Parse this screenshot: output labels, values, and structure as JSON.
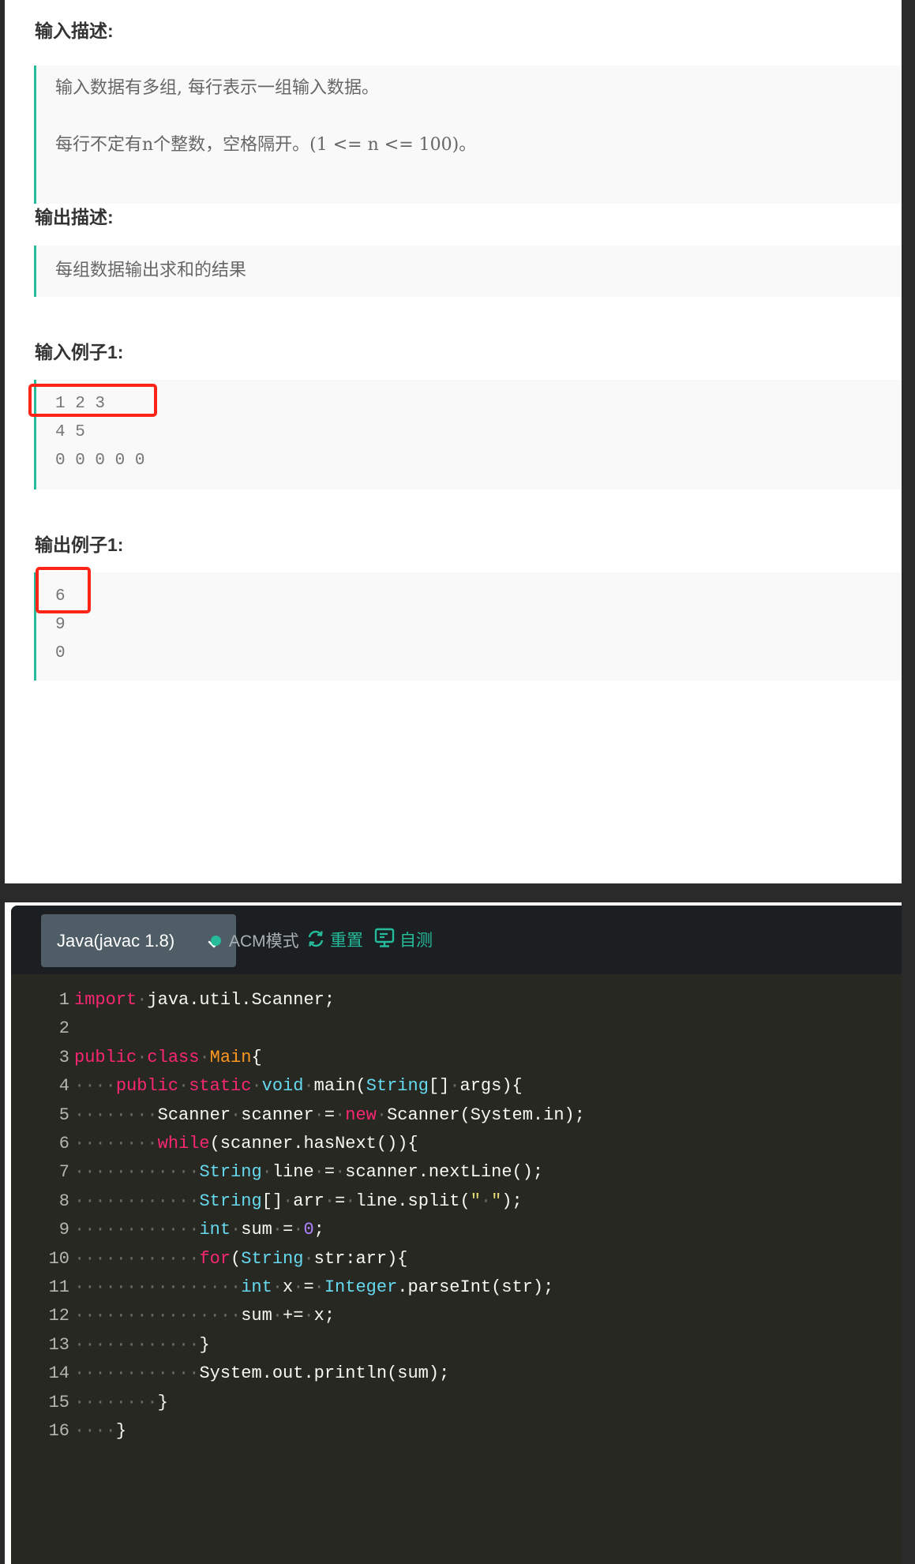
{
  "problem": {
    "sections": [
      {
        "heading": "输入描述:",
        "lines": [
          "输入数据有多组, 每行表示一组输入数据。",
          "每行不定有n个整数，空格隔开。(1 <= n <= 100)。"
        ]
      },
      {
        "heading": "输出描述:",
        "lines": [
          "每组数据输出求和的结果"
        ]
      },
      {
        "heading": "输入例子1:",
        "lines": [
          "1 2 3",
          "4 5",
          "0 0 0 0 0"
        ]
      },
      {
        "heading": "输出例子1:",
        "lines": [
          "6",
          "9",
          "0"
        ]
      }
    ],
    "highlight_color": "#ff2418",
    "accent_color": "#25bb9b"
  },
  "editor": {
    "language": "Java(javac 1.8)",
    "mode_label": "ACM模式",
    "reset_label": "重置",
    "selftest_label": "自测",
    "icons": {
      "dropdown": "chevron-down-icon",
      "mode": "status-dot-icon",
      "reset": "refresh-icon",
      "selftest": "monitor-icon"
    },
    "code_lines": [
      {
        "n": "1",
        "tokens": [
          [
            "kw",
            "import"
          ],
          [
            "ws",
            "·"
          ],
          [
            "p",
            "java.util.Scanner;"
          ]
        ]
      },
      {
        "n": "2",
        "tokens": []
      },
      {
        "n": "3",
        "tokens": [
          [
            "kw",
            "public"
          ],
          [
            "ws",
            "·"
          ],
          [
            "kw",
            "class"
          ],
          [
            "ws",
            "·"
          ],
          [
            "cl",
            "Main"
          ],
          [
            "p",
            "{"
          ]
        ]
      },
      {
        "n": "4",
        "tokens": [
          [
            "ws",
            "····"
          ],
          [
            "kw",
            "public"
          ],
          [
            "ws",
            "·"
          ],
          [
            "kw",
            "static"
          ],
          [
            "ws",
            "·"
          ],
          [
            "ty",
            "void"
          ],
          [
            "ws",
            "·"
          ],
          [
            "p",
            "main("
          ],
          [
            "ty",
            "String"
          ],
          [
            "p",
            "[]"
          ],
          [
            "ws",
            "·"
          ],
          [
            "p",
            "args){"
          ]
        ]
      },
      {
        "n": "5",
        "tokens": [
          [
            "ws",
            "········"
          ],
          [
            "p",
            "Scanner"
          ],
          [
            "ws",
            "·"
          ],
          [
            "p",
            "scanner"
          ],
          [
            "ws",
            "·"
          ],
          [
            "p",
            "="
          ],
          [
            "ws",
            "·"
          ],
          [
            "kw",
            "new"
          ],
          [
            "ws",
            "·"
          ],
          [
            "p",
            "Scanner(System.in);"
          ]
        ]
      },
      {
        "n": "6",
        "tokens": [
          [
            "ws",
            "········"
          ],
          [
            "kw",
            "while"
          ],
          [
            "p",
            "(scanner.hasNext()){"
          ]
        ]
      },
      {
        "n": "7",
        "tokens": [
          [
            "ws",
            "············"
          ],
          [
            "ty",
            "String"
          ],
          [
            "ws",
            "·"
          ],
          [
            "p",
            "line"
          ],
          [
            "ws",
            "·"
          ],
          [
            "p",
            "="
          ],
          [
            "ws",
            "·"
          ],
          [
            "p",
            "scanner.nextLine();"
          ]
        ]
      },
      {
        "n": "8",
        "tokens": [
          [
            "ws",
            "············"
          ],
          [
            "ty",
            "String"
          ],
          [
            "p",
            "[]"
          ],
          [
            "ws",
            "·"
          ],
          [
            "p",
            "arr"
          ],
          [
            "ws",
            "·"
          ],
          [
            "p",
            "="
          ],
          [
            "ws",
            "·"
          ],
          [
            "p",
            "line.split("
          ],
          [
            "str",
            "\""
          ],
          [
            "ws",
            "·"
          ],
          [
            "str",
            "\""
          ],
          [
            "p",
            ");"
          ]
        ]
      },
      {
        "n": "9",
        "tokens": [
          [
            "ws",
            "············"
          ],
          [
            "ty",
            "int"
          ],
          [
            "ws",
            "·"
          ],
          [
            "p",
            "sum"
          ],
          [
            "ws",
            "·"
          ],
          [
            "p",
            "="
          ],
          [
            "ws",
            "·"
          ],
          [
            "num",
            "0"
          ],
          [
            "p",
            ";"
          ]
        ]
      },
      {
        "n": "10",
        "tokens": [
          [
            "ws",
            "············"
          ],
          [
            "kw",
            "for"
          ],
          [
            "p",
            "("
          ],
          [
            "ty",
            "String"
          ],
          [
            "ws",
            "·"
          ],
          [
            "p",
            "str:arr){"
          ]
        ]
      },
      {
        "n": "11",
        "tokens": [
          [
            "ws",
            "················"
          ],
          [
            "ty",
            "int"
          ],
          [
            "ws",
            "·"
          ],
          [
            "p",
            "x"
          ],
          [
            "ws",
            "·"
          ],
          [
            "p",
            "="
          ],
          [
            "ws",
            "·"
          ],
          [
            "ty",
            "Integer"
          ],
          [
            "p",
            ".parseInt(str);"
          ]
        ]
      },
      {
        "n": "12",
        "tokens": [
          [
            "ws",
            "················"
          ],
          [
            "p",
            "sum"
          ],
          [
            "ws",
            "·"
          ],
          [
            "p",
            "+="
          ],
          [
            "ws",
            "·"
          ],
          [
            "p",
            "x;"
          ]
        ]
      },
      {
        "n": "13",
        "tokens": [
          [
            "ws",
            "············"
          ],
          [
            "p",
            "}"
          ]
        ]
      },
      {
        "n": "14",
        "tokens": [
          [
            "ws",
            "············"
          ],
          [
            "p",
            "System.out.println(sum);"
          ]
        ]
      },
      {
        "n": "15",
        "tokens": [
          [
            "ws",
            "········"
          ],
          [
            "p",
            "}"
          ]
        ]
      },
      {
        "n": "16",
        "tokens": [
          [
            "ws",
            "····"
          ],
          [
            "p",
            "}"
          ]
        ]
      }
    ]
  }
}
